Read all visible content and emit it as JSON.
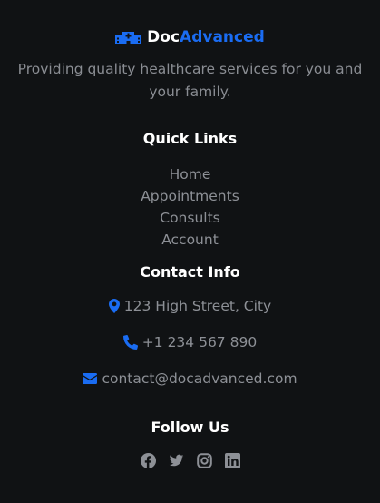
{
  "brand": {
    "name_part1": "Doc",
    "name_part2": "Advanced",
    "accent_color": "#1a6cf2",
    "icon": "hospital-icon"
  },
  "tagline": "Providing quality healthcare services for you and your family.",
  "quick_links": {
    "title": "Quick Links",
    "items": [
      "Home",
      "Appointments",
      "Consults",
      "Account"
    ]
  },
  "contact": {
    "title": "Contact Info",
    "address": "123 High Street, City",
    "phone": "+1 234 567 890",
    "email": "contact@docadvanced.com",
    "icons": [
      "map-pin-icon",
      "phone-icon",
      "envelope-icon"
    ]
  },
  "follow": {
    "title": "Follow Us",
    "icons": [
      "facebook-icon",
      "twitter-icon",
      "instagram-icon",
      "linkedin-icon"
    ]
  }
}
